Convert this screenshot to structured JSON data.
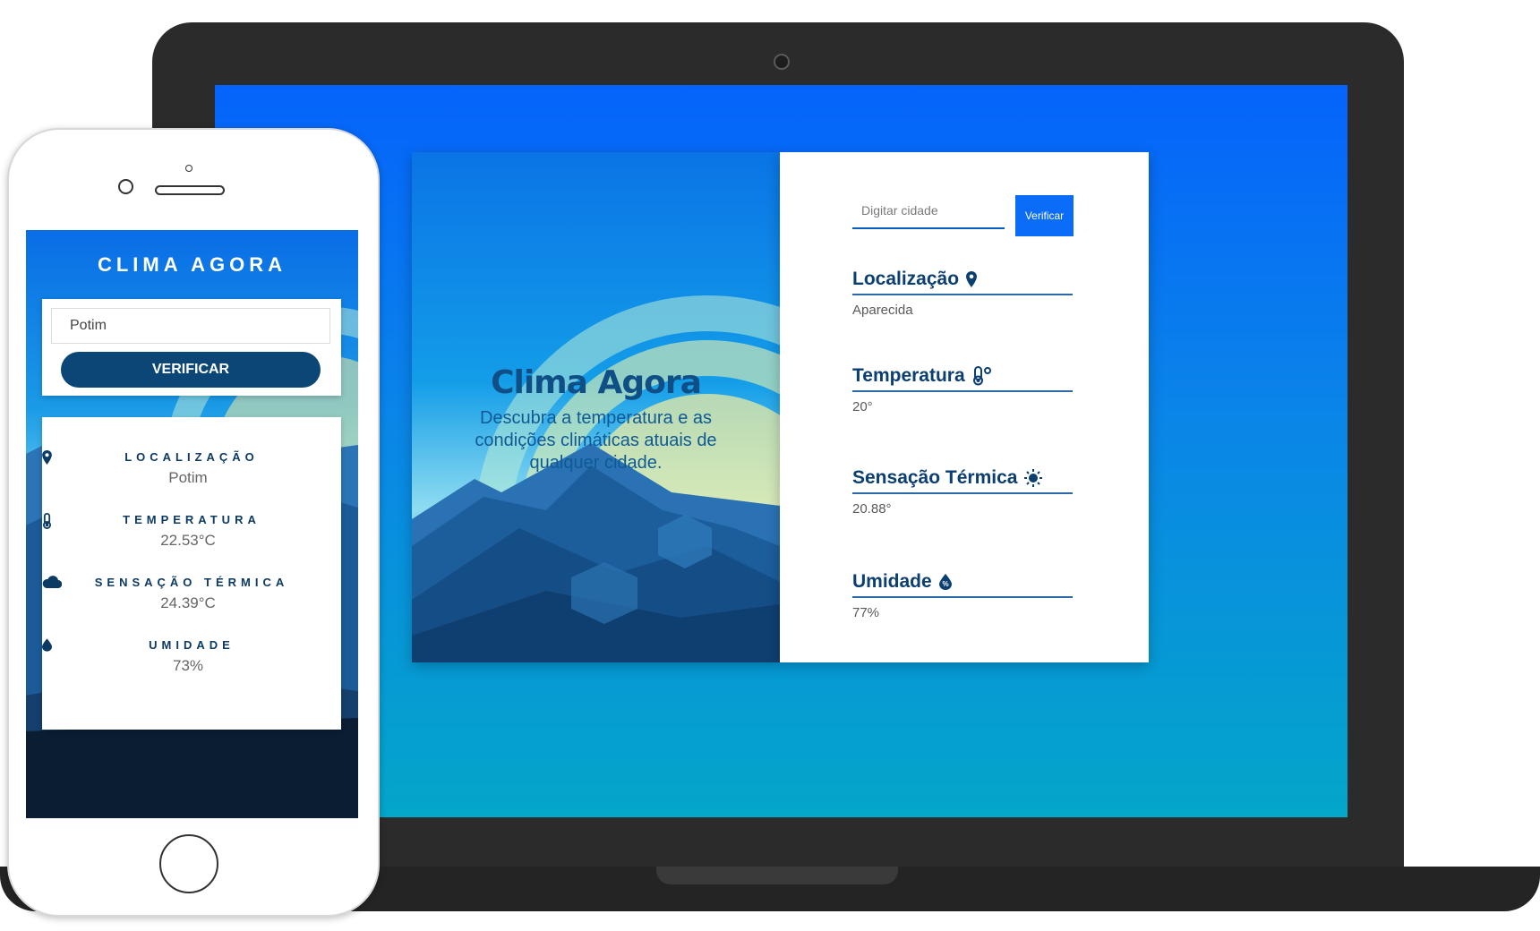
{
  "desktop": {
    "hero": {
      "title": "Clima Agora",
      "subtitle": "Descubra a temperatura e as condições climáticas atuais de qualquer cidade."
    },
    "search": {
      "placeholder": "Digitar cidade",
      "button_label": "Verificar"
    },
    "info": [
      {
        "label": "Localização",
        "value": "Aparecida",
        "icon": "map-pin-icon"
      },
      {
        "label": "Temperatura",
        "value": "20°",
        "icon": "thermometer-icon"
      },
      {
        "label": "Sensação Térmica",
        "value": "20.88°",
        "icon": "sun-icon"
      },
      {
        "label": "Umidade",
        "value": "77%",
        "icon": "humidity-drop-icon"
      }
    ]
  },
  "mobile": {
    "title": "CLIMA AGORA",
    "search": {
      "value": "Potim",
      "button_label": "VERIFICAR"
    },
    "info": [
      {
        "label": "LOCALIZAÇÃO",
        "value": "Potim",
        "icon": "map-pin-icon"
      },
      {
        "label": "TEMPERATURA",
        "value": "22.53°C",
        "icon": "thermometer-icon"
      },
      {
        "label": "SENSAÇÃO TÉRMICA",
        "value": "24.39°C",
        "icon": "cloud-icon"
      },
      {
        "label": "UMIDADE",
        "value": "73%",
        "icon": "water-drop-icon"
      }
    ]
  },
  "colors": {
    "primary_blue": "#0a6cf7",
    "dark_navy": "#0b3f71",
    "phone_button": "#0c4676",
    "laptop_frame": "#2b2b2b"
  }
}
